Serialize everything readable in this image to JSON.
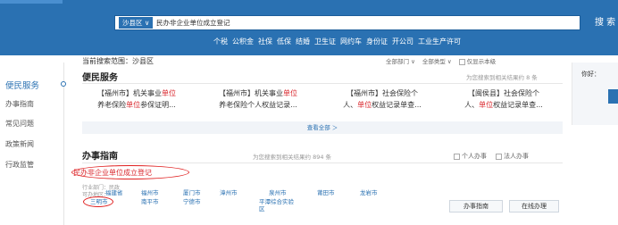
{
  "header": {
    "area_select": "沙县区 ∨",
    "search_value": "民办非企业单位成立登记",
    "search_button": "搜 索",
    "hot_words": [
      "个税",
      "公积金",
      "社保",
      "低保",
      "结婚",
      "卫生证",
      "网约车",
      "身份证",
      "开公司",
      "工业生产许可"
    ]
  },
  "sidebar": {
    "items": [
      "便民服务",
      "办事指南",
      "常见问题",
      "政策新闻",
      "行政监管"
    ]
  },
  "scope": {
    "text": "当前搜索范围：沙县区",
    "dept_filter": "全部部门 ∨",
    "type_filter": "全部类型 ∨",
    "local_only": "仅显示本级"
  },
  "convenience": {
    "title": "便民服务",
    "count": "为您搜索到相关结果约 8 条",
    "cards": [
      {
        "l1a": "【福州市】机关事业",
        "l1b": "单位",
        "l1c": "",
        "l2a": "养老保险",
        "l2b": "单位",
        "l2c": "参保证明..."
      },
      {
        "l1a": "【福州市】机关事业",
        "l1b": "单位",
        "l1c": "",
        "l2a": "养老保险个人权益记录...",
        "l2b": "",
        "l2c": ""
      },
      {
        "l1a": "【福州市】社会保险个",
        "l1b": "",
        "l1c": "",
        "l2a": "人、",
        "l2b": "单位",
        "l2c": "权益记录单查..."
      },
      {
        "l1a": "【闽侯县】社会保险个",
        "l1b": "",
        "l1c": "",
        "l2a": "人、",
        "l2b": "单位",
        "l2c": "权益记录单查..."
      }
    ],
    "view_all": "查看全部 ＞"
  },
  "guide": {
    "title": "办事指南",
    "count": "为您搜索到相关结果约 894 条",
    "tabs": [
      "个人办事",
      "法人办事"
    ],
    "item_title": "民办非企业单位成立登记",
    "dept": "行业部门：民政",
    "area_label": "可办地区：",
    "regions": [
      "福建省",
      "福州市",
      "厦门市",
      "漳州市",
      "泉州市",
      "莆田市",
      "龙岩市",
      "三明市",
      "南平市",
      "宁德市",
      "平潭综合实验",
      "区"
    ],
    "buttons": [
      "办事指南",
      "在线办理"
    ]
  },
  "right_panel": {
    "text": "你好："
  }
}
